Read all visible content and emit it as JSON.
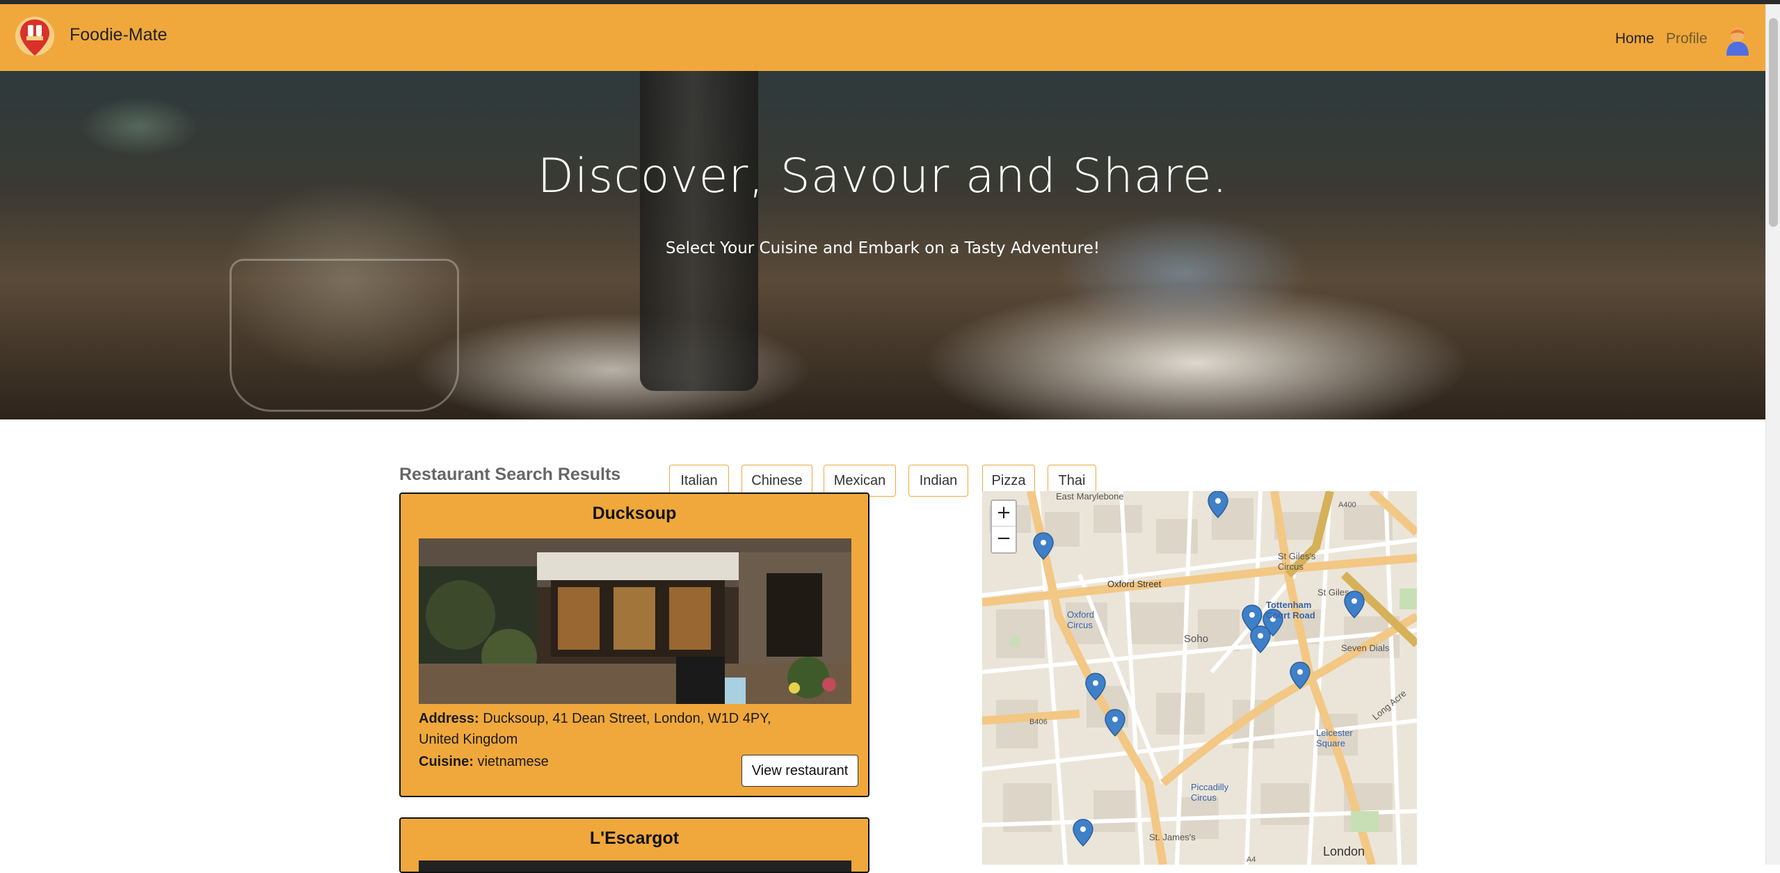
{
  "app": {
    "brand": "Foodie-Mate"
  },
  "nav": {
    "home": "Home",
    "profile": "Profile"
  },
  "hero": {
    "title": "Discover, Savour and Share.",
    "subtitle": "Select Your Cuisine and Embark on a Tasty Adventure!"
  },
  "results": {
    "title": "Restaurant Search Results",
    "filters": [
      "Italian",
      "Chinese",
      "Mexican",
      "Indian",
      "Pizza",
      "Thai"
    ]
  },
  "restaurants": [
    {
      "name": "Ducksoup",
      "address_label": "Address:",
      "address": "Ducksoup, 41 Dean Street, London, W1D 4PY, United Kingdom",
      "cuisine_label": "Cuisine:",
      "cuisine": "vietnamese",
      "button": "View restaurant"
    },
    {
      "name": "L'Escargot"
    }
  ],
  "map": {
    "zoom_in": "+",
    "zoom_out": "−",
    "labels": {
      "east_marylebone": "East Marylebone",
      "oxford_street": "Oxford Street",
      "oxford_circus": "Oxford Circus",
      "soho": "Soho",
      "st_giles_circus": "St Giles's Circus",
      "st_giles": "St Giles",
      "tottenham": "Tottenham Court Road",
      "seven_dials": "Seven Dials",
      "leicester": "Leicester Square",
      "piccadilly": "Piccadilly Circus",
      "london": "London",
      "a400": "A400",
      "b406": "B406",
      "a4": "A4",
      "long_acre": "Long Acre",
      "st_james": "St. James's"
    },
    "pin_color": "#3f80c9",
    "pin_count": 11
  },
  "colors": {
    "accent": "#f0a83c"
  }
}
